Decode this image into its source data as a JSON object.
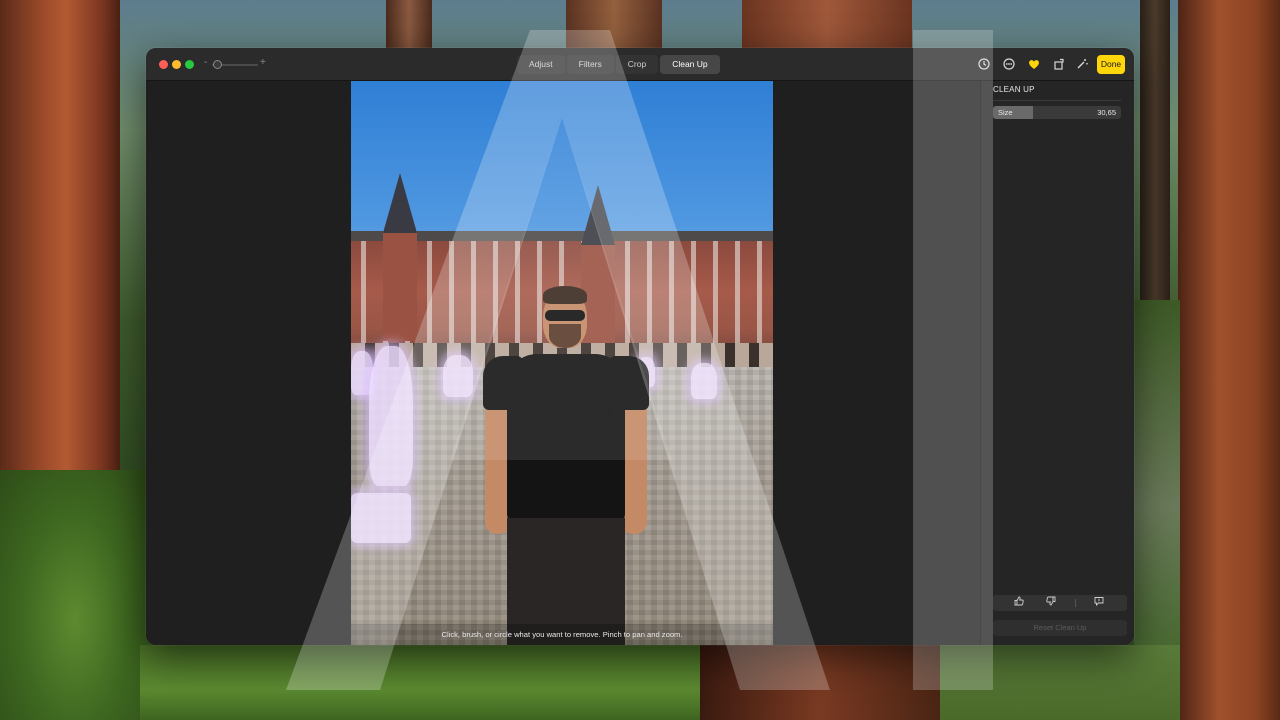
{
  "window": {
    "tabs": [
      {
        "label": "Adjust",
        "active": false
      },
      {
        "label": "Filters",
        "active": false
      },
      {
        "label": "Crop",
        "active": false
      },
      {
        "label": "Clean Up",
        "active": true
      }
    ],
    "zoom": {
      "minus": "-",
      "plus": "+",
      "level": 0.05
    },
    "toolbar": {
      "icons": [
        "history-icon",
        "more-icon",
        "heart-icon",
        "rotate-icon",
        "magic-wand-icon"
      ],
      "done_label": "Done"
    }
  },
  "canvas": {
    "hint": "Click, brush, or circle what you want to remove. Pinch to pan and zoom."
  },
  "sidebar": {
    "title": "CLEAN UP",
    "size": {
      "label": "Size",
      "value": "30,65",
      "fraction": 0.3065
    },
    "feedback_icons": [
      "thumbs-up-icon",
      "thumbs-down-icon",
      "report-icon"
    ],
    "reset_label": "Reset Clean Up"
  },
  "colors": {
    "accent": "#ffd60a",
    "highlight": "#e6d4ff"
  }
}
